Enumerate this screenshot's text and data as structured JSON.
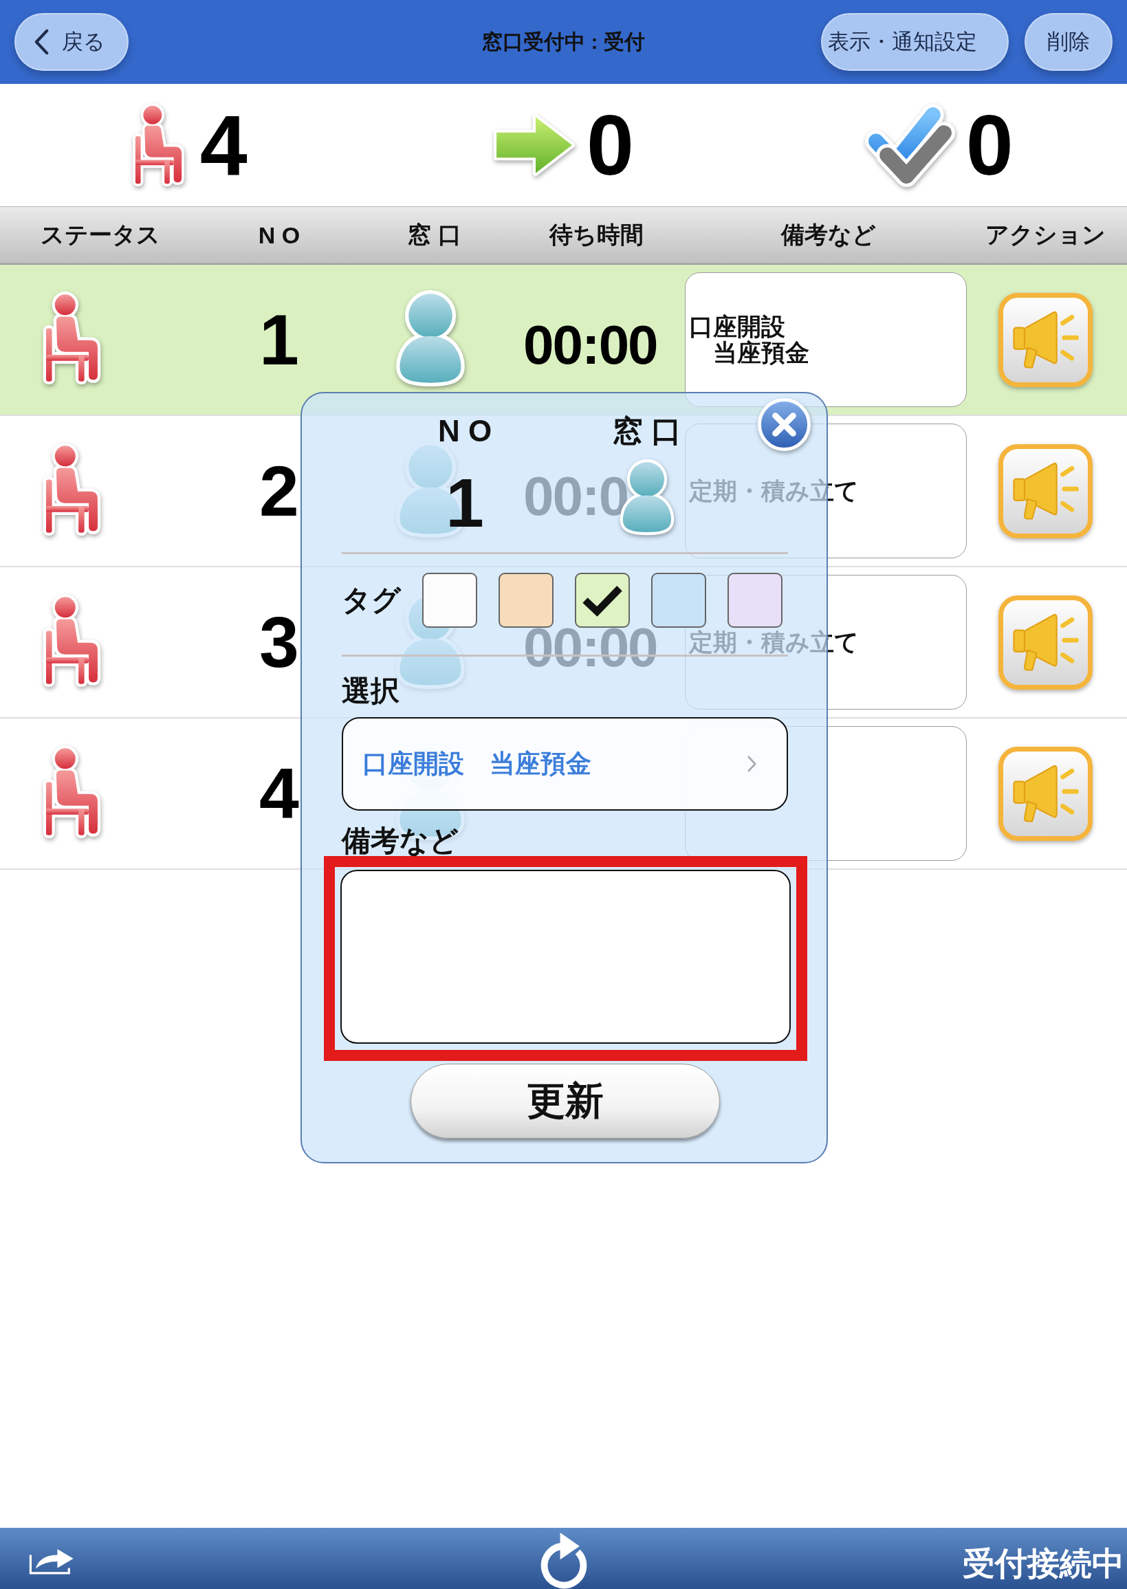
{
  "header": {
    "back_button": "戻る",
    "title": "窓口受付中 : 受付",
    "buttons": [
      "表示・通知設定",
      "削除"
    ]
  },
  "summary": [
    {
      "kind": "waiting",
      "count": "4"
    },
    {
      "kind": "called",
      "count": "0"
    },
    {
      "kind": "done",
      "count": "0"
    }
  ],
  "table": {
    "columns": [
      "ステータス",
      "N O",
      "窓 口",
      "待ち時間",
      "備考など",
      "アクション"
    ],
    "rows": [
      {
        "kind": "waiting",
        "number": "1",
        "wait_time": "00:00",
        "note": [
          "口座開設",
          "当座預金"
        ],
        "selected": true
      },
      {
        "kind": "waiting",
        "number": "2",
        "wait_time": "00:0",
        "note": [
          "定期・積み立て"
        ],
        "selected": false
      },
      {
        "kind": "waiting",
        "number": "3",
        "wait_time": "00:00",
        "note": [
          "定期・積み立て"
        ],
        "selected": false
      },
      {
        "kind": "waiting",
        "number": "4",
        "selected": false
      }
    ]
  },
  "dialog": {
    "number_label": "N O",
    "number": "1",
    "counter_label": "窓 口",
    "tag_label": "タグ",
    "tags": [
      {
        "color": "#fcfcfd",
        "checked": false
      },
      {
        "color": "#f6dcbb",
        "checked": false
      },
      {
        "color": "#dff2c3",
        "checked": true
      },
      {
        "color": "#c8e2f8",
        "checked": false
      },
      {
        "color": "#e8e0f8",
        "checked": false
      }
    ],
    "selection_label": "選択",
    "selection_value": "口座開設　当座預金",
    "remarks_label": "備考など",
    "remarks": {
      "highlighted": true
    },
    "submit_button": "更新"
  },
  "status_bar": {
    "text": "受付接続中"
  }
}
